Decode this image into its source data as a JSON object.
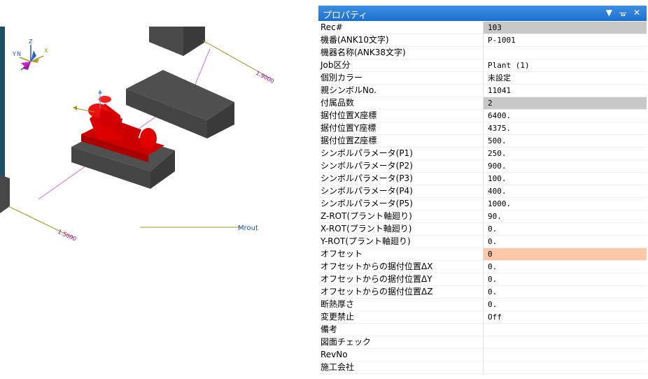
{
  "viewport": {
    "dim_1": "1.9000",
    "dim_2": "1.5000",
    "mrout_label": "Mrout",
    "axis_labels": {
      "x": "X",
      "y": "Y",
      "z": "Z",
      "n": "N"
    },
    "colors": {
      "equipment": "#dd0000",
      "block": "#4a4a4a",
      "dim_line": "#d000d0",
      "axis": "#9a9a20"
    }
  },
  "panel": {
    "title": "プロパティ",
    "buttons": {
      "dropdown": "▼",
      "pin": "ᚗ",
      "close": "✕"
    },
    "rows": [
      {
        "name": "Rec#",
        "value": "103",
        "style": "gray"
      },
      {
        "name": "機番(ANK10文字)",
        "value": "P-1001",
        "style": ""
      },
      {
        "name": "機器名称(ANK38文字)",
        "value": "",
        "style": ""
      },
      {
        "name": "Job区分",
        "value": "Plant (1)",
        "style": ""
      },
      {
        "name": "個別カラー",
        "value": "未設定",
        "style": ""
      },
      {
        "name": "親シンボルNo.",
        "value": "11041",
        "style": ""
      },
      {
        "name": "付属品数",
        "value": "2",
        "style": "gray"
      },
      {
        "name": "据付位置X座標",
        "value": "6400.",
        "style": ""
      },
      {
        "name": "据付位置Y座標",
        "value": "4375.",
        "style": ""
      },
      {
        "name": "据付位置Z座標",
        "value": "500.",
        "style": ""
      },
      {
        "name": "シンボルパラメータ(P1)",
        "value": "250.",
        "style": ""
      },
      {
        "name": "シンボルパラメータ(P2)",
        "value": "900.",
        "style": ""
      },
      {
        "name": "シンボルパラメータ(P3)",
        "value": "100.",
        "style": ""
      },
      {
        "name": "シンボルパラメータ(P4)",
        "value": "400.",
        "style": ""
      },
      {
        "name": "シンボルパラメータ(P5)",
        "value": "1000.",
        "style": ""
      },
      {
        "name": "Z-ROT(プラント軸廻り)",
        "value": "90.",
        "style": ""
      },
      {
        "name": "X-ROT(プラント軸廻り)",
        "value": "0.",
        "style": ""
      },
      {
        "name": "Y-ROT(プラント軸廻り)",
        "value": "0.",
        "style": ""
      },
      {
        "name": "オフセット",
        "value": "0",
        "style": "orange"
      },
      {
        "name": "オフセットからの据付位置ΔX",
        "value": "0.",
        "style": ""
      },
      {
        "name": "オフセットからの据付位置ΔY",
        "value": "0.",
        "style": ""
      },
      {
        "name": "オフセットからの据付位置ΔZ",
        "value": "0.",
        "style": ""
      },
      {
        "name": "断熱厚さ",
        "value": "0.",
        "style": ""
      },
      {
        "name": "変更禁止",
        "value": "Off",
        "style": ""
      },
      {
        "name": "備考",
        "value": "",
        "style": ""
      },
      {
        "name": "図面チェック",
        "value": "",
        "style": ""
      },
      {
        "name": "RevNo",
        "value": "",
        "style": ""
      },
      {
        "name": "施工会社",
        "value": "",
        "style": ""
      }
    ]
  }
}
